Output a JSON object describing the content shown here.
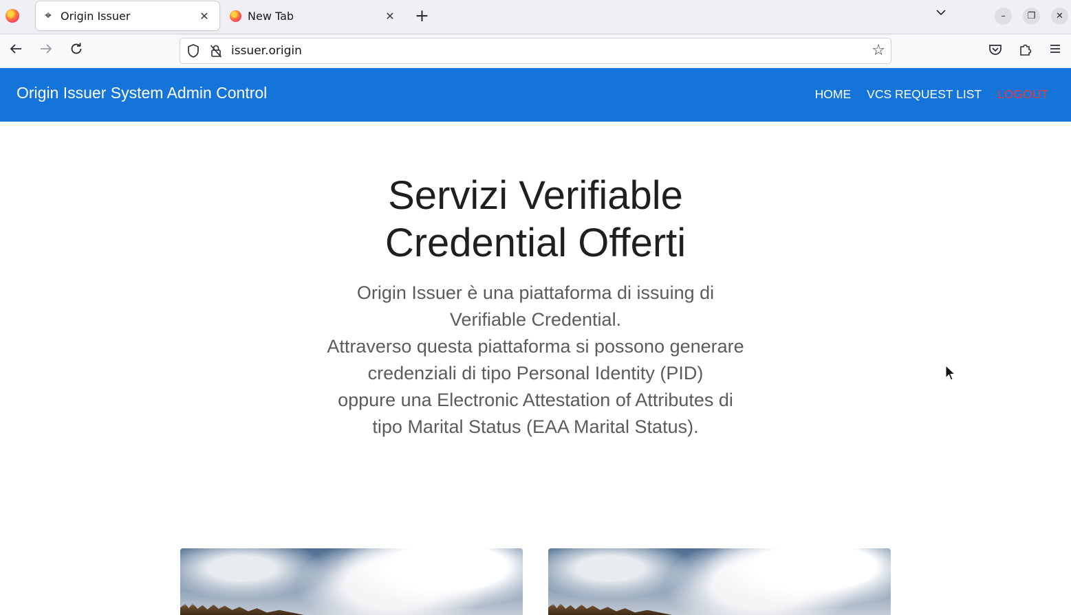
{
  "browser": {
    "tabs": [
      {
        "title": "Origin Issuer",
        "active": true,
        "icon": "crosshair-icon"
      },
      {
        "title": "New Tab",
        "active": false,
        "icon": "firefox-icon"
      }
    ],
    "new_tab_symbol": "+",
    "close_symbol": "✕",
    "url": "issuer.origin"
  },
  "site": {
    "brand": "Origin Issuer System Admin Control",
    "nav": {
      "home": "HOME",
      "vcs_request_list": "VCS REQUEST LIST",
      "logout": "LOGOUT"
    },
    "colors": {
      "header_bg": "#1474d9",
      "logout": "#e53e3e"
    }
  },
  "hero": {
    "title_line1": "Servizi Verifiable",
    "title_line2": "Credential Offerti",
    "desc_line1": "Origin Issuer è una piattaforma di issuing di",
    "desc_line2": "Verifiable Credential.",
    "desc_line3": "Attraverso questa piattaforma si possono generare",
    "desc_line4": "credenziali di tipo Personal Identity (PID)",
    "desc_line5": "oppure una Electronic Attestation of Attributes di",
    "desc_line6": "tipo Marital Status (EAA Marital Status)."
  }
}
